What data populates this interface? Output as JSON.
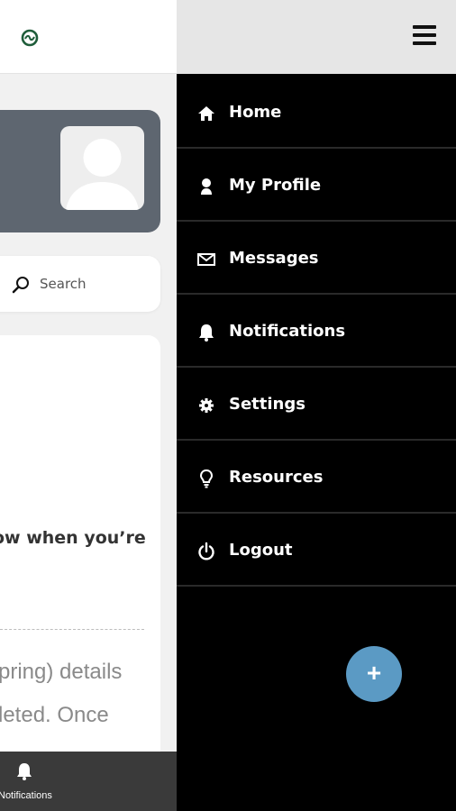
{
  "page": {
    "search_label": "Search",
    "content_bold": "ow when you’re",
    "content_light_line1": "pring) details",
    "content_light_line2": "leted. Once"
  },
  "bottom_nav": {
    "notifications_label": "Notifications"
  },
  "drawer": {
    "items": [
      {
        "label": "Home",
        "icon": "home-icon"
      },
      {
        "label": "My Profile",
        "icon": "user-icon"
      },
      {
        "label": "Messages",
        "icon": "envelope-icon"
      },
      {
        "label": "Notifications",
        "icon": "bell-icon"
      },
      {
        "label": "Settings",
        "icon": "gear-icon"
      },
      {
        "label": "Resources",
        "icon": "lightbulb-icon"
      },
      {
        "label": "Logout",
        "icon": "power-icon"
      }
    ]
  },
  "fab": {
    "symbol": "+"
  },
  "colors": {
    "drawer_bg": "#000000",
    "profile_card": "#5e6670",
    "fab": "#5b9ac4",
    "bottom_nav": "#3a3a3a",
    "logo": "#1f5d3a"
  }
}
